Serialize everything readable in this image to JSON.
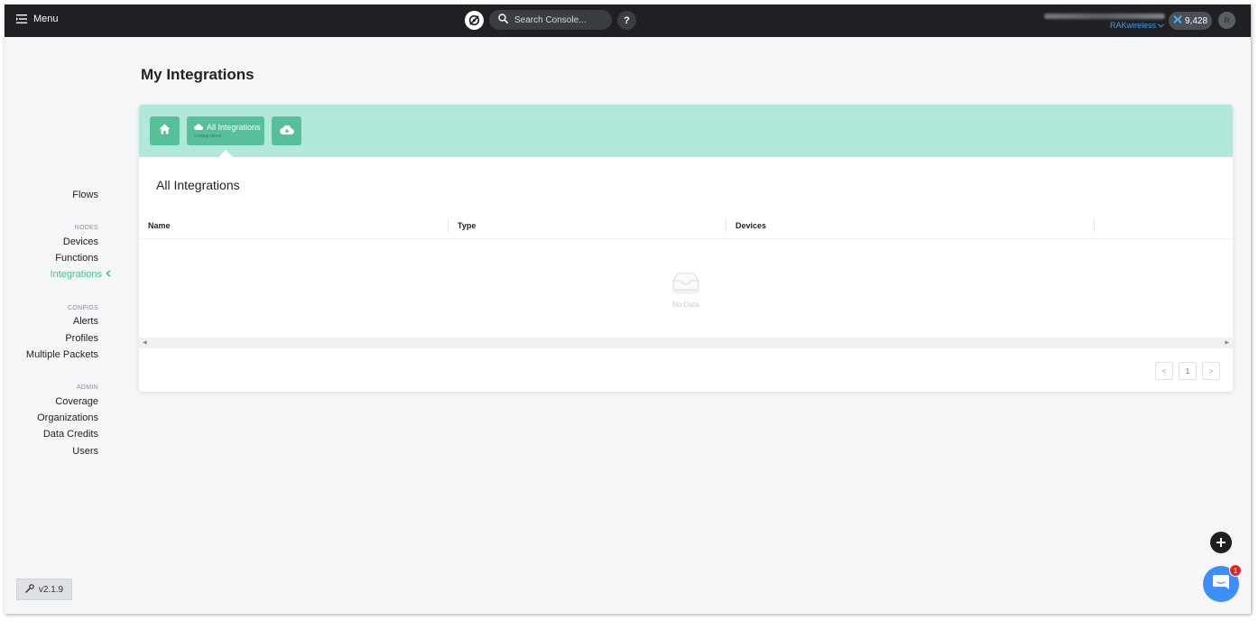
{
  "topbar": {
    "menu_label": "Menu",
    "search_placeholder": "Search Console...",
    "help_label": "?",
    "org_name": "RAKwireless",
    "credits": "9,428",
    "avatar_initial": "R"
  },
  "sidebar": {
    "flows": "Flows",
    "nodes_header": "NODES",
    "devices": "Devices",
    "functions": "Functions",
    "integrations": "Integrations",
    "configs_header": "CONFIGS",
    "alerts": "Alerts",
    "profiles": "Profiles",
    "multiple_packets": "Multiple Packets",
    "admin_header": "ADMIN",
    "coverage": "Coverage",
    "organizations": "Organizations",
    "data_credits": "Data Credits",
    "users": "Users",
    "version": "v2.1.9"
  },
  "main": {
    "page_title": "My Integrations",
    "tabs": {
      "all_title": "All Integrations",
      "all_count": "0 Integrations"
    },
    "section_title": "All Integrations",
    "table": {
      "columns": [
        "Name",
        "Type",
        "Devices"
      ],
      "empty_text": "No Data"
    },
    "pagination": {
      "prev": "<",
      "current": "1",
      "next": ">"
    }
  },
  "chat": {
    "badge": "1"
  },
  "colors": {
    "topbar": "#1e2023",
    "accent_green": "#36c98e",
    "panel_header": "#b2e8d9",
    "tile": "#58bf9b",
    "link_blue": "#3b9ff5",
    "chat_blue": "#3e8ef7"
  }
}
